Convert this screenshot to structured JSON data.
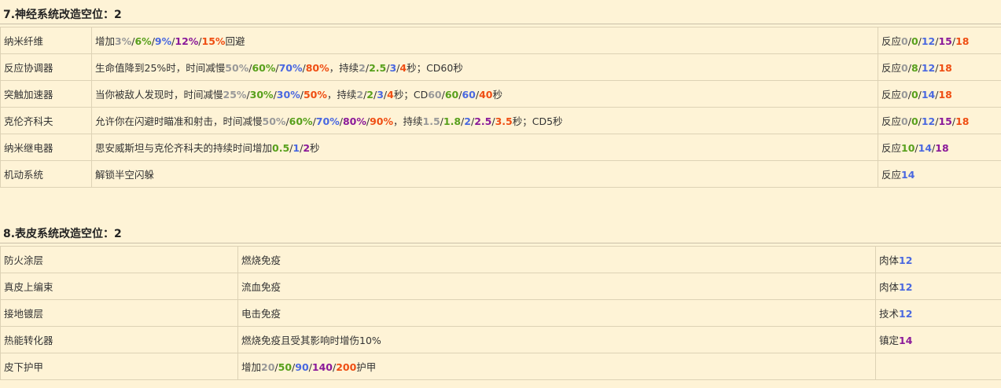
{
  "colors": {
    "tier_gray": "#999999",
    "tier_green": "#58a01c",
    "tier_blue": "#4a68e0",
    "tier_purple": "#8b1a9a",
    "tier_orange": "#ef4e13"
  },
  "sections": [
    {
      "id": "s7",
      "title": "7.神经系统改造空位：2",
      "rows": [
        {
          "name": "纳米纤维",
          "desc": [
            [
              "增加",
              null
            ],
            [
              "3%",
              0
            ],
            [
              "/",
              null
            ],
            [
              "6%",
              1
            ],
            [
              "/",
              null
            ],
            [
              "9%",
              2
            ],
            [
              "/",
              null
            ],
            [
              "12%",
              3
            ],
            [
              "/",
              null
            ],
            [
              "15%",
              4
            ],
            [
              "回避",
              null
            ]
          ],
          "req": [
            [
              "反应",
              null
            ],
            [
              "0",
              0
            ],
            [
              "/",
              null
            ],
            [
              "0",
              1
            ],
            [
              "/",
              null
            ],
            [
              "12",
              2
            ],
            [
              "/",
              null
            ],
            [
              "15",
              3
            ],
            [
              "/",
              null
            ],
            [
              "18",
              4
            ]
          ]
        },
        {
          "name": "反应协调器",
          "desc": [
            [
              "生命值降到25%时，时间减慢",
              null
            ],
            [
              "50%",
              0
            ],
            [
              "/",
              null
            ],
            [
              "60%",
              1
            ],
            [
              "/",
              null
            ],
            [
              "70%",
              2
            ],
            [
              "/",
              null
            ],
            [
              "80%",
              4
            ],
            [
              "，持续",
              null
            ],
            [
              "2",
              0
            ],
            [
              "/",
              null
            ],
            [
              "2.5",
              1
            ],
            [
              "/",
              null
            ],
            [
              "3",
              2
            ],
            [
              "/",
              null
            ],
            [
              "4",
              4
            ],
            [
              "秒；CD60秒",
              null
            ]
          ],
          "req": [
            [
              "反应",
              null
            ],
            [
              "0",
              0
            ],
            [
              "/",
              null
            ],
            [
              "8",
              1
            ],
            [
              "/",
              null
            ],
            [
              "12",
              2
            ],
            [
              "/",
              null
            ],
            [
              "18",
              4
            ]
          ]
        },
        {
          "name": "突触加速器",
          "desc": [
            [
              "当你被敌人发现时，时间减慢",
              null
            ],
            [
              "25%",
              0
            ],
            [
              "/",
              null
            ],
            [
              "30%",
              1
            ],
            [
              "/",
              null
            ],
            [
              "30%",
              2
            ],
            [
              "/",
              null
            ],
            [
              "50%",
              4
            ],
            [
              "，持续",
              null
            ],
            [
              "2",
              0
            ],
            [
              "/",
              null
            ],
            [
              "2",
              1
            ],
            [
              "/",
              null
            ],
            [
              "3",
              2
            ],
            [
              "/",
              null
            ],
            [
              "4",
              4
            ],
            [
              "秒；CD",
              null
            ],
            [
              "60",
              0
            ],
            [
              "/",
              null
            ],
            [
              "60",
              1
            ],
            [
              "/",
              null
            ],
            [
              "60",
              2
            ],
            [
              "/",
              null
            ],
            [
              "40",
              4
            ],
            [
              "秒",
              null
            ]
          ],
          "req": [
            [
              "反应",
              null
            ],
            [
              "0",
              0
            ],
            [
              "/",
              null
            ],
            [
              "0",
              1
            ],
            [
              "/",
              null
            ],
            [
              "14",
              2
            ],
            [
              "/",
              null
            ],
            [
              "18",
              4
            ]
          ]
        },
        {
          "name": "克伦齐科夫",
          "desc": [
            [
              "允许你在闪避时瞄准和射击，时间减慢",
              null
            ],
            [
              "50%",
              0
            ],
            [
              "/",
              null
            ],
            [
              "60%",
              1
            ],
            [
              "/",
              null
            ],
            [
              "70%",
              2
            ],
            [
              "/",
              null
            ],
            [
              "80%",
              3
            ],
            [
              "/",
              null
            ],
            [
              "90%",
              4
            ],
            [
              "，持续",
              null
            ],
            [
              "1.5",
              0
            ],
            [
              "/",
              null
            ],
            [
              "1.8",
              1
            ],
            [
              "/",
              null
            ],
            [
              "2",
              2
            ],
            [
              "/",
              null
            ],
            [
              "2.5",
              3
            ],
            [
              "/",
              null
            ],
            [
              "3.5",
              4
            ],
            [
              "秒；CD5秒",
              null
            ]
          ],
          "req": [
            [
              "反应",
              null
            ],
            [
              "0",
              0
            ],
            [
              "/",
              null
            ],
            [
              "0",
              1
            ],
            [
              "/",
              null
            ],
            [
              "12",
              2
            ],
            [
              "/",
              null
            ],
            [
              "15",
              3
            ],
            [
              "/",
              null
            ],
            [
              "18",
              4
            ]
          ]
        },
        {
          "name": "纳米继电器",
          "desc": [
            [
              "思安威斯坦与克伦齐科夫的持续时间增加",
              null
            ],
            [
              "0.5",
              1
            ],
            [
              "/",
              null
            ],
            [
              "1",
              2
            ],
            [
              "/",
              null
            ],
            [
              "2",
              3
            ],
            [
              "秒",
              null
            ]
          ],
          "req": [
            [
              "反应",
              null
            ],
            [
              "10",
              1
            ],
            [
              "/",
              null
            ],
            [
              "14",
              2
            ],
            [
              "/",
              null
            ],
            [
              "18",
              3
            ]
          ]
        },
        {
          "name": "机动系统",
          "desc": [
            [
              "解锁半空闪躲",
              null
            ]
          ],
          "req": [
            [
              "反应",
              null
            ],
            [
              "14",
              2
            ]
          ]
        }
      ]
    },
    {
      "id": "s8",
      "title": "8.表皮系统改造空位：2",
      "rows": [
        {
          "name": "防火涂层",
          "desc": [
            [
              "燃烧免疫",
              null
            ]
          ],
          "req": [
            [
              "肉体",
              null
            ],
            [
              "12",
              2
            ]
          ]
        },
        {
          "name": "真皮上编束",
          "desc": [
            [
              "流血免疫",
              null
            ]
          ],
          "req": [
            [
              "肉体",
              null
            ],
            [
              "12",
              2
            ]
          ]
        },
        {
          "name": "接地镀层",
          "desc": [
            [
              "电击免疫",
              null
            ]
          ],
          "req": [
            [
              "技术",
              null
            ],
            [
              "12",
              2
            ]
          ]
        },
        {
          "name": "热能转化器",
          "desc": [
            [
              "燃烧免疫且受其影响时增伤10%",
              null
            ]
          ],
          "req": [
            [
              "镇定",
              null
            ],
            [
              "14",
              3
            ]
          ]
        },
        {
          "name": "皮下护甲",
          "desc": [
            [
              "增加",
              null
            ],
            [
              "20",
              0
            ],
            [
              "/",
              null
            ],
            [
              "50",
              1
            ],
            [
              "/",
              null
            ],
            [
              "90",
              2
            ],
            [
              "/",
              null
            ],
            [
              "140",
              3
            ],
            [
              "/",
              null
            ],
            [
              "200",
              4
            ],
            [
              "护甲",
              null
            ]
          ],
          "req": []
        }
      ]
    }
  ]
}
